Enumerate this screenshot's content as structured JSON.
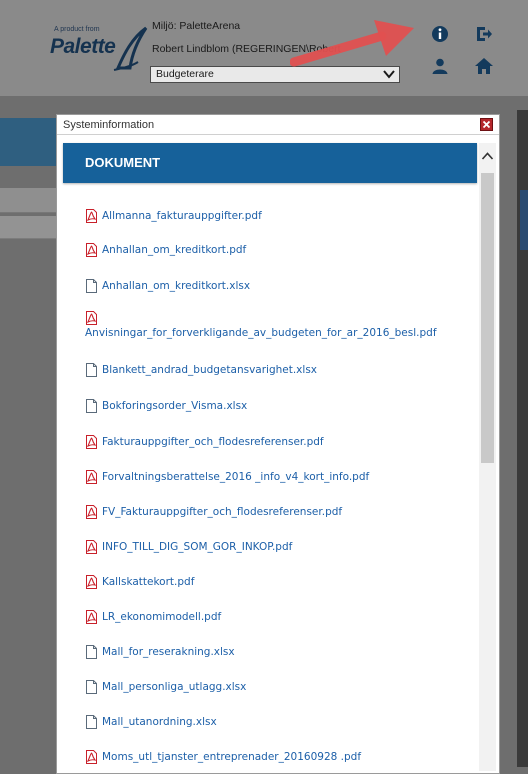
{
  "header": {
    "logo_small": "A product from",
    "logo_big": "Palette",
    "environment": "Miljö: PaletteArena",
    "user": "Robert Lindblom (REGERINGEN\\Robert",
    "role_selected": "Budgeterare"
  },
  "dialog": {
    "title": "Systeminformation",
    "section_title": "DOKUMENT",
    "documents": [
      {
        "name": "Allmanna_fakturauppgifter.pdf",
        "type": "pdf"
      },
      {
        "name": "Anhallan_om_kreditkort.pdf",
        "type": "pdf"
      },
      {
        "name": "Anhallan_om_kreditkort.xlsx",
        "type": "file"
      },
      {
        "name": "Anvisningar_for_forverkligande_av_budgeten_for_ar_2016_besl.pdf",
        "type": "pdf"
      },
      {
        "name": "Blankett_andrad_budgetansvarighet.xlsx",
        "type": "file"
      },
      {
        "name": "Bokforingsorder_Visma.xlsx",
        "type": "file"
      },
      {
        "name": "Fakturauppgifter_och_flodesreferenser.pdf",
        "type": "pdf"
      },
      {
        "name": "Forvaltningsberattelse_2016 _info_v4_kort_info.pdf",
        "type": "pdf"
      },
      {
        "name": "FV_Fakturauppgifter_och_flodesreferenser.pdf",
        "type": "pdf"
      },
      {
        "name": "INFO_TILL_DIG_SOM_GOR_INKOP.pdf",
        "type": "pdf"
      },
      {
        "name": "Kallskattekort.pdf",
        "type": "pdf"
      },
      {
        "name": "LR_ekonomimodell.pdf",
        "type": "pdf"
      },
      {
        "name": "Mall_for_reserakning.xlsx",
        "type": "file"
      },
      {
        "name": "Mall_personliga_utlagg.xlsx",
        "type": "file"
      },
      {
        "name": "Mall_utanordning.xlsx",
        "type": "file"
      },
      {
        "name": "Moms_utl_tjanster_entreprenader_20160928 .pdf",
        "type": "pdf"
      }
    ]
  },
  "colors": {
    "accent": "#16619a",
    "link": "#1c5fa8",
    "pdf_icon": "#c8202a",
    "arrow": "#e05050"
  },
  "icons": {
    "info": "info-icon",
    "logout": "logout-icon",
    "user": "user-icon",
    "home": "home-icon"
  }
}
